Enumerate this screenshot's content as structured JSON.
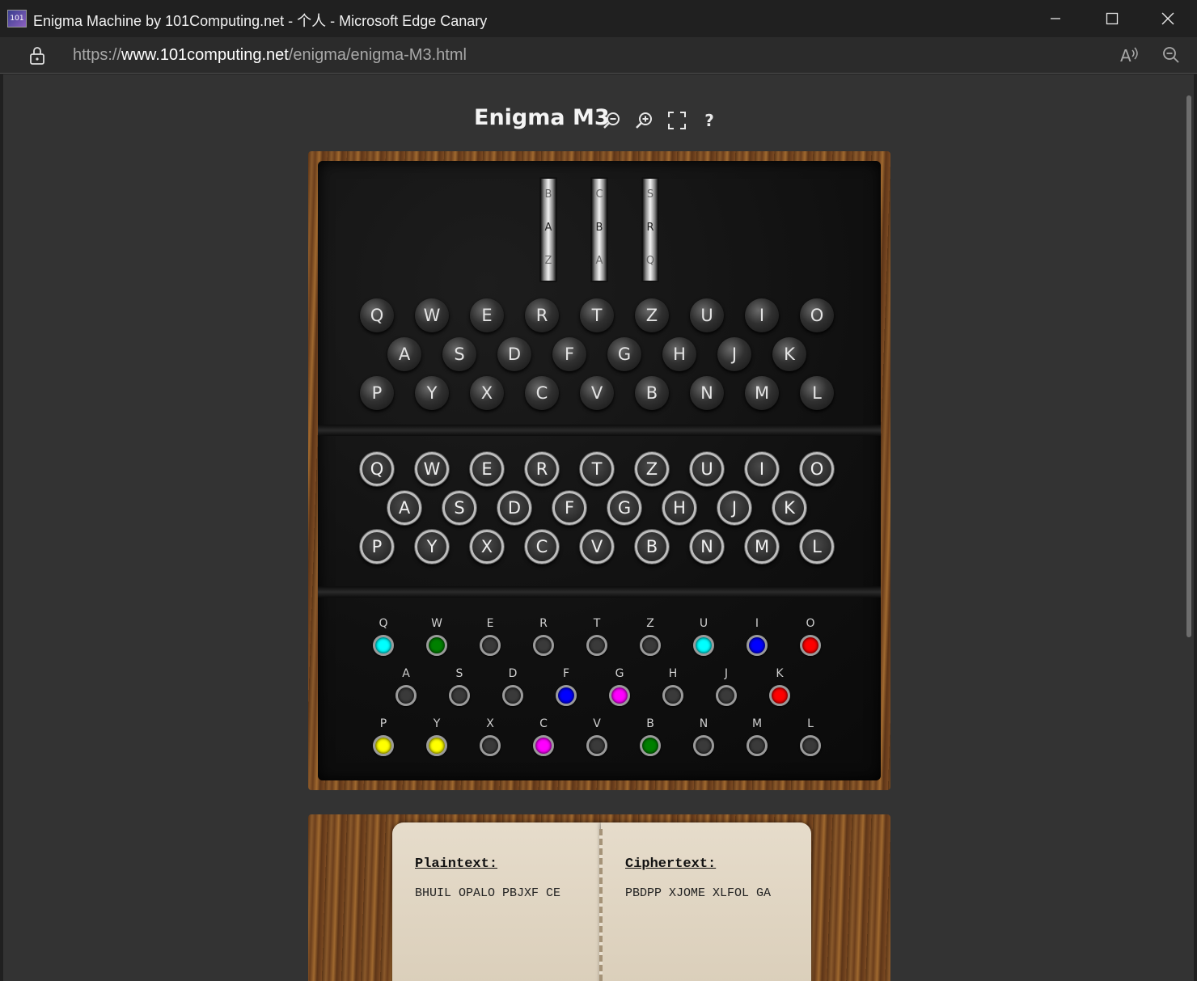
{
  "window": {
    "icon_text": "101",
    "title": "Enigma Machine by 101Computing.net - 个人 - Microsoft Edge Canary",
    "minimize_icon": "minimize-icon",
    "maximize_icon": "maximize-icon",
    "close_icon": "close-icon"
  },
  "address": {
    "scheme": "https://",
    "host": "www.101computing.net",
    "path": "/enigma/enigma-M3.html"
  },
  "page": {
    "title": "Enigma M3",
    "help_label": "?"
  },
  "rotors": [
    {
      "prev": "B",
      "current": "A",
      "next": "Z"
    },
    {
      "prev": "C",
      "current": "B",
      "next": "A"
    },
    {
      "prev": "S",
      "current": "R",
      "next": "Q"
    }
  ],
  "lampboard": {
    "rows": [
      [
        "Q",
        "W",
        "E",
        "R",
        "T",
        "Z",
        "U",
        "I",
        "O"
      ],
      [
        "A",
        "S",
        "D",
        "F",
        "G",
        "H",
        "J",
        "K"
      ],
      [
        "P",
        "Y",
        "X",
        "C",
        "V",
        "B",
        "N",
        "M",
        "L"
      ]
    ]
  },
  "keyboard": {
    "rows": [
      [
        "Q",
        "W",
        "E",
        "R",
        "T",
        "Z",
        "U",
        "I",
        "O"
      ],
      [
        "A",
        "S",
        "D",
        "F",
        "G",
        "H",
        "J",
        "K"
      ],
      [
        "P",
        "Y",
        "X",
        "C",
        "V",
        "B",
        "N",
        "M",
        "L"
      ]
    ]
  },
  "plugboard": {
    "rows": [
      [
        {
          "l": "Q",
          "c": "#00ffff"
        },
        {
          "l": "W",
          "c": "#008000"
        },
        {
          "l": "E",
          "c": ""
        },
        {
          "l": "R",
          "c": ""
        },
        {
          "l": "T",
          "c": ""
        },
        {
          "l": "Z",
          "c": ""
        },
        {
          "l": "U",
          "c": "#00ffff"
        },
        {
          "l": "I",
          "c": "#0000ff"
        },
        {
          "l": "O",
          "c": "#ff0000"
        }
      ],
      [
        {
          "l": "A",
          "c": ""
        },
        {
          "l": "S",
          "c": ""
        },
        {
          "l": "D",
          "c": ""
        },
        {
          "l": "F",
          "c": "#0000ff"
        },
        {
          "l": "G",
          "c": "#ff00ff"
        },
        {
          "l": "H",
          "c": ""
        },
        {
          "l": "J",
          "c": ""
        },
        {
          "l": "K",
          "c": "#ff0000"
        }
      ],
      [
        {
          "l": "P",
          "c": "#ffff00"
        },
        {
          "l": "Y",
          "c": "#ffff00"
        },
        {
          "l": "X",
          "c": ""
        },
        {
          "l": "C",
          "c": "#ff00ff"
        },
        {
          "l": "V",
          "c": ""
        },
        {
          "l": "B",
          "c": "#008000"
        },
        {
          "l": "N",
          "c": ""
        },
        {
          "l": "M",
          "c": ""
        },
        {
          "l": "L",
          "c": ""
        }
      ]
    ]
  },
  "notebook": {
    "plaintext_heading": "Plaintext:",
    "plaintext": "BHUIL OPALO PBJXF CE",
    "ciphertext_heading": "Ciphertext:",
    "ciphertext": "PBDPP XJOME XLFOL GA"
  }
}
